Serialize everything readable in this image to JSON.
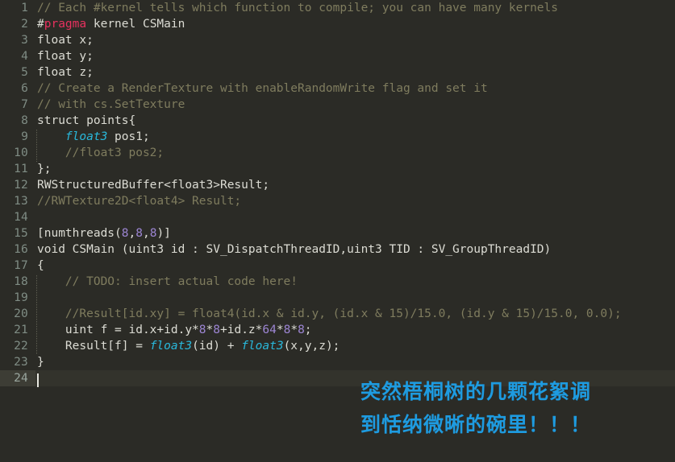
{
  "editor": {
    "language": "HLSL Compute Shader",
    "theme_colors": {
      "background": "#2b2b26",
      "foreground": "#dcdcd4",
      "comment": "#7f7c5e",
      "preprocessor": "#e8315f",
      "type": "#29b8db",
      "number": "#9d86d4",
      "gutter_text": "#7f8c84",
      "active_line_gutter": "#3d3d35",
      "active_line": "#33332c",
      "caret": "#e8e8e0",
      "overlay_text": "#1e9be0"
    },
    "active_line_number": 24,
    "caret_line": 24,
    "caret_column": 1,
    "gutter_numbers": [
      "1",
      "2",
      "3",
      "4",
      "5",
      "6",
      "7",
      "8",
      "9",
      "10",
      "11",
      "12",
      "13",
      "14",
      "15",
      "16",
      "17",
      "18",
      "19",
      "20",
      "21",
      "22",
      "23",
      "24"
    ],
    "lines": [
      {
        "n": 1,
        "tokens": [
          {
            "t": "// Each #kernel tells which function to compile; you can have many kernels",
            "c": "com"
          }
        ]
      },
      {
        "n": 2,
        "tokens": [
          {
            "t": "#",
            "c": "txt"
          },
          {
            "t": "pragma",
            "c": "pre"
          },
          {
            "t": " kernel CSMain",
            "c": "txt"
          }
        ]
      },
      {
        "n": 3,
        "tokens": [
          {
            "t": "float x;",
            "c": "txt"
          }
        ]
      },
      {
        "n": 4,
        "tokens": [
          {
            "t": "float y;",
            "c": "txt"
          }
        ]
      },
      {
        "n": 5,
        "tokens": [
          {
            "t": "float z;",
            "c": "txt"
          }
        ]
      },
      {
        "n": 6,
        "tokens": [
          {
            "t": "// Create a RenderTexture with enableRandomWrite flag and set it",
            "c": "com"
          }
        ]
      },
      {
        "n": 7,
        "tokens": [
          {
            "t": "// with cs.SetTexture",
            "c": "com"
          }
        ]
      },
      {
        "n": 8,
        "tokens": [
          {
            "t": "struct points{",
            "c": "txt"
          }
        ]
      },
      {
        "n": 9,
        "tokens": [
          {
            "t": "    ",
            "c": "txt"
          },
          {
            "t": "float3",
            "c": "type"
          },
          {
            "t": " pos1;",
            "c": "txt"
          }
        ]
      },
      {
        "n": 10,
        "tokens": [
          {
            "t": "    //float3 pos2;",
            "c": "com"
          }
        ]
      },
      {
        "n": 11,
        "tokens": [
          {
            "t": "};",
            "c": "txt"
          }
        ]
      },
      {
        "n": 12,
        "tokens": [
          {
            "t": "RWStructuredBuffer<float3>Result;",
            "c": "txt"
          }
        ]
      },
      {
        "n": 13,
        "tokens": [
          {
            "t": "//RWTexture2D<float4> Result;",
            "c": "com"
          }
        ]
      },
      {
        "n": 14,
        "tokens": [
          {
            "t": "",
            "c": "txt"
          }
        ]
      },
      {
        "n": 15,
        "tokens": [
          {
            "t": "[numthreads(",
            "c": "txt"
          },
          {
            "t": "8",
            "c": "num"
          },
          {
            "t": ",",
            "c": "txt"
          },
          {
            "t": "8",
            "c": "num"
          },
          {
            "t": ",",
            "c": "txt"
          },
          {
            "t": "8",
            "c": "num"
          },
          {
            "t": ")]",
            "c": "txt"
          }
        ]
      },
      {
        "n": 16,
        "tokens": [
          {
            "t": "void CSMain (uint3 id : SV_DispatchThreadID,uint3 TID : SV_GroupThreadID)",
            "c": "txt"
          }
        ]
      },
      {
        "n": 17,
        "tokens": [
          {
            "t": "{",
            "c": "txt"
          }
        ]
      },
      {
        "n": 18,
        "tokens": [
          {
            "t": "    // TODO: insert actual code here!",
            "c": "com"
          }
        ]
      },
      {
        "n": 19,
        "tokens": [
          {
            "t": "",
            "c": "txt"
          }
        ]
      },
      {
        "n": 20,
        "tokens": [
          {
            "t": "    //Result[id.xy] = float4(id.x & id.y, (id.x & 15)/15.0, (id.y & 15)/15.0, 0.0);",
            "c": "com"
          }
        ]
      },
      {
        "n": 21,
        "tokens": [
          {
            "t": "    uint f = id.x+id.y*",
            "c": "txt"
          },
          {
            "t": "8",
            "c": "num"
          },
          {
            "t": "*",
            "c": "txt"
          },
          {
            "t": "8",
            "c": "num"
          },
          {
            "t": "+id.z*",
            "c": "txt"
          },
          {
            "t": "64",
            "c": "num"
          },
          {
            "t": "*",
            "c": "txt"
          },
          {
            "t": "8",
            "c": "num"
          },
          {
            "t": "*",
            "c": "txt"
          },
          {
            "t": "8",
            "c": "num"
          },
          {
            "t": ";",
            "c": "txt"
          }
        ]
      },
      {
        "n": 22,
        "tokens": [
          {
            "t": "    Result[f] = ",
            "c": "txt"
          },
          {
            "t": "float3",
            "c": "type"
          },
          {
            "t": "(id) + ",
            "c": "txt"
          },
          {
            "t": "float3",
            "c": "type"
          },
          {
            "t": "(x,y,z);",
            "c": "txt"
          }
        ]
      },
      {
        "n": 23,
        "tokens": [
          {
            "t": "}",
            "c": "txt"
          }
        ]
      },
      {
        "n": 24,
        "tokens": [
          {
            "t": "",
            "c": "txt"
          }
        ]
      }
    ]
  },
  "overlay": {
    "lines": [
      "突然梧桐树的几颗花絮调",
      "到恬纳微晰的碗里！！！"
    ]
  }
}
